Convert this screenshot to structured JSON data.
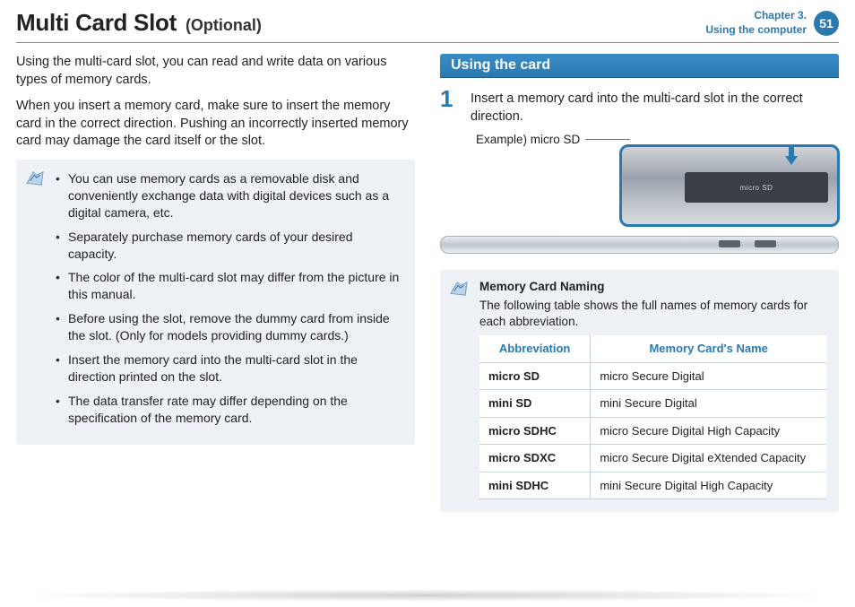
{
  "header": {
    "title": "Multi Card Slot",
    "subtitle": "(Optional)",
    "chapter_line1": "Chapter 3.",
    "chapter_line2": "Using the computer",
    "page_number": "51"
  },
  "left": {
    "para1": "Using the multi-card slot, you can read and write data on various types of memory cards.",
    "para2": "When you insert a memory card, make sure to insert the memory card in the correct direction. Pushing an incorrectly inserted memory card may damage the card itself or the slot.",
    "notes": [
      "You can use memory cards as a removable disk and conveniently exchange data with digital devices such as a digital camera, etc.",
      "Separately purchase memory cards of your desired capacity.",
      "The color of the multi-card slot may differ from the picture in this manual.",
      "Before using the slot, remove the dummy card from inside the slot. (Only for models providing dummy cards.)",
      "Insert the memory card into the multi-card slot in the direction printed on the slot.",
      "The data transfer rate may differ depending on the specification of the memory card."
    ]
  },
  "right": {
    "section_title": "Using the card",
    "step1_num": "1",
    "step1_text": "Insert a memory card into the multi-card slot in the correct direction.",
    "diagram_label": "Example) micro SD",
    "slot_text": "micro SD",
    "naming_title": "Memory Card Naming",
    "naming_intro": "The following table shows the full names of memory cards for each abbreviation.",
    "table": {
      "head_abbr": "Abbreviation",
      "head_name": "Memory Card's Name",
      "rows": [
        {
          "abbr": "micro SD",
          "name": "micro Secure Digital"
        },
        {
          "abbr": "mini SD",
          "name": "mini Secure Digital"
        },
        {
          "abbr": "micro SDHC",
          "name": "micro Secure Digital High Capacity"
        },
        {
          "abbr": "micro SDXC",
          "name": "micro Secure Digital eXtended Capacity"
        },
        {
          "abbr": "mini SDHC",
          "name": "mini Secure Digital High Capacity"
        }
      ]
    }
  }
}
